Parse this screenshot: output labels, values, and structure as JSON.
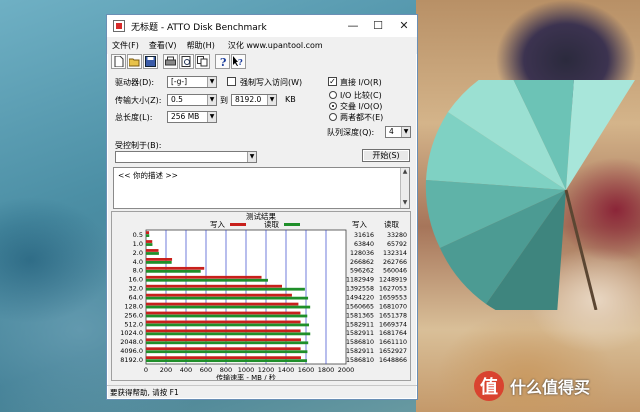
{
  "window": {
    "title": "无标题 - ATTO Disk Benchmark",
    "minimize_glyph": "—",
    "maximize_glyph": "☐",
    "close_glyph": "✕"
  },
  "menu": {
    "items": [
      "文件(F)",
      "查看(V)",
      "帮助(H)"
    ],
    "url_text": "汉化 www.upantool.com"
  },
  "toolbar": {
    "icons": [
      "new-file-icon",
      "open-folder-icon",
      "save-icon",
      "print-icon",
      "print-preview-icon",
      "copy-icon",
      "about-icon",
      "help-icon"
    ]
  },
  "settings": {
    "drive_label": "驱动器(D):",
    "drive_value": "[-g-]",
    "force_write_label": "强制写入访问(W)",
    "transfer_size_label": "传输大小(Z):",
    "transfer_from": "0.5",
    "transfer_to_label": "到",
    "transfer_to": "8192.0",
    "transfer_unit": "KB",
    "total_length_label": "总长度(L):",
    "total_length_value": "256 MB",
    "direct_io_label": "直接 I/O(R)",
    "direct_io_checked": true,
    "io_compare_label": "I/O 比较(C)",
    "overlapped_io_label": "交叠 I/O(O)",
    "neither_label": "两者都不(E)",
    "queue_depth_label": "队列深度(Q):",
    "queue_depth_value": "4",
    "controlled_by_label": "受控制于(B):",
    "controlled_by_value": "",
    "start_button": "开始(S)",
    "description": "<<  你的描述  >>"
  },
  "results": {
    "title": "测试结果",
    "write_legend": "写入",
    "read_legend": "读取",
    "col_write": "写入",
    "col_read": "读取",
    "xlabel": "传输速率 - MB / 秒",
    "write_color": "#c8201c",
    "read_color": "#1f8f2a"
  },
  "chart_data": {
    "type": "bar",
    "orientation": "horizontal",
    "title": "测试结果",
    "xlabel": "传输速率 - MB / 秒",
    "xlim": [
      0,
      2000
    ],
    "xticks": [
      "0",
      "200",
      "400",
      "600",
      "800",
      "1000",
      "1200",
      "1400",
      "1600",
      "1800",
      "2000"
    ],
    "categories": [
      "0.5",
      "1.0",
      "2.0",
      "4.0",
      "8.0",
      "16.0",
      "32.0",
      "64.0",
      "128.0",
      "256.0",
      "512.0",
      "1024.0",
      "2048.0",
      "4096.0",
      "8192.0"
    ],
    "series": [
      {
        "name": "写入",
        "values_kb": [
          31616,
          63840,
          128036,
          266862,
          596262,
          1182949,
          1392558,
          1494220,
          1560665,
          1581365,
          1582911,
          1582911,
          1586810,
          1582911,
          1586810
        ]
      },
      {
        "name": "读取",
        "values_kb": [
          33280,
          65792,
          132314,
          262766,
          560046,
          1248919,
          1627053,
          1659553,
          1681070,
          1651378,
          1669374,
          1681764,
          1661110,
          1652927,
          1648866
        ]
      }
    ]
  },
  "status": {
    "text": "要获得帮助, 请按 F1"
  },
  "wallpaper": {
    "logo_mark": "值",
    "logo_text": "什么值得买"
  }
}
